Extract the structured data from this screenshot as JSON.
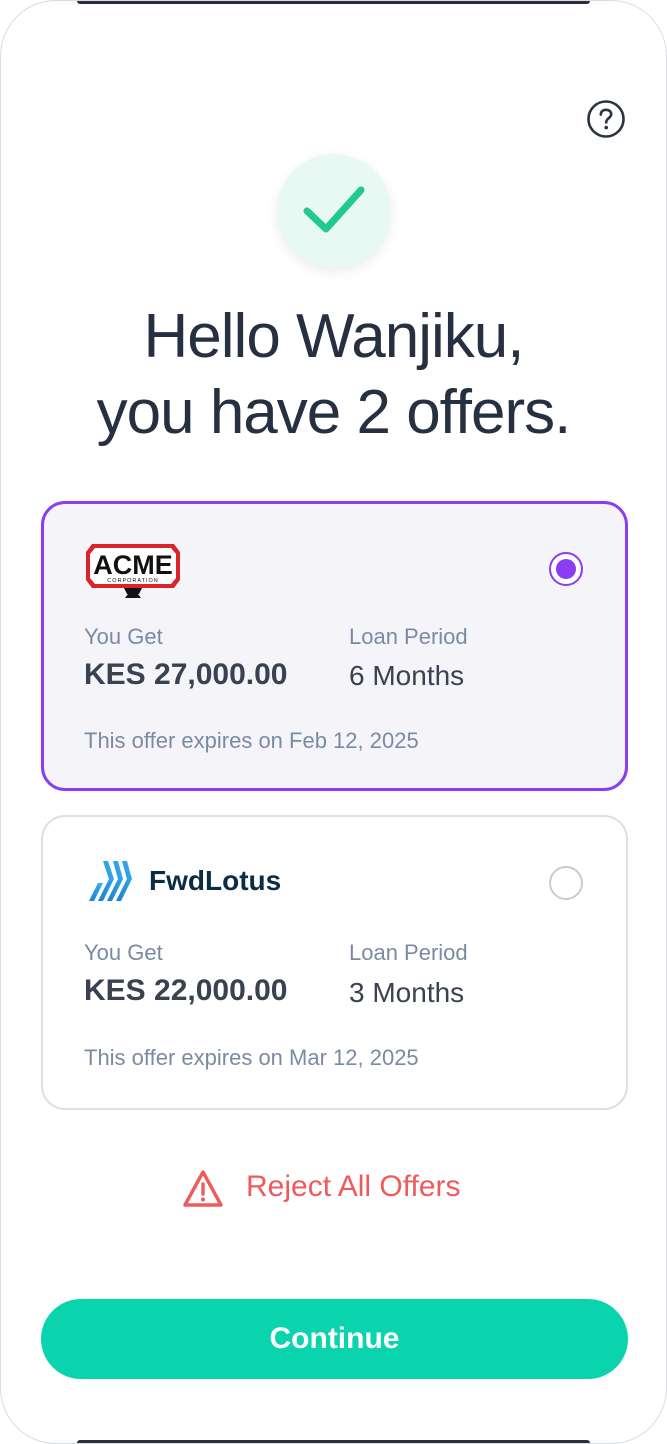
{
  "header": {
    "help_icon": "question-circle-icon",
    "success_icon": "checkmark-icon"
  },
  "greeting": {
    "line1": "Hello Wanjiku,",
    "line2": "you have 2 offers."
  },
  "offers": [
    {
      "lender_logo": "acme-corporation-logo",
      "logo_text": "ACME",
      "logo_subtext": "CORPORATION",
      "you_get_label": "You Get",
      "amount": "KES 27,000.00",
      "loan_period_label": "Loan Period",
      "loan_period": "6 Months",
      "expiry": "This offer expires on Feb 12, 2025",
      "selected": true
    },
    {
      "lender_logo": "fwdlotus-logo",
      "lender_name": "FwdLotus",
      "you_get_label": "You Get",
      "amount": "KES 22,000.00",
      "loan_period_label": "Loan Period",
      "loan_period": "3 Months",
      "expiry": "This offer expires on Mar 12, 2025",
      "selected": false
    }
  ],
  "reject": {
    "icon": "warning-triangle-icon",
    "label": "Reject All Offers"
  },
  "continue_button": {
    "label": "Continue"
  },
  "colors": {
    "accent_purple": "#8a3df2",
    "primary_teal": "#0ad4ad",
    "danger_red": "#ee5b5b",
    "success_green": "#1fc98f",
    "heading": "#273040",
    "muted": "#7b8aa4"
  }
}
